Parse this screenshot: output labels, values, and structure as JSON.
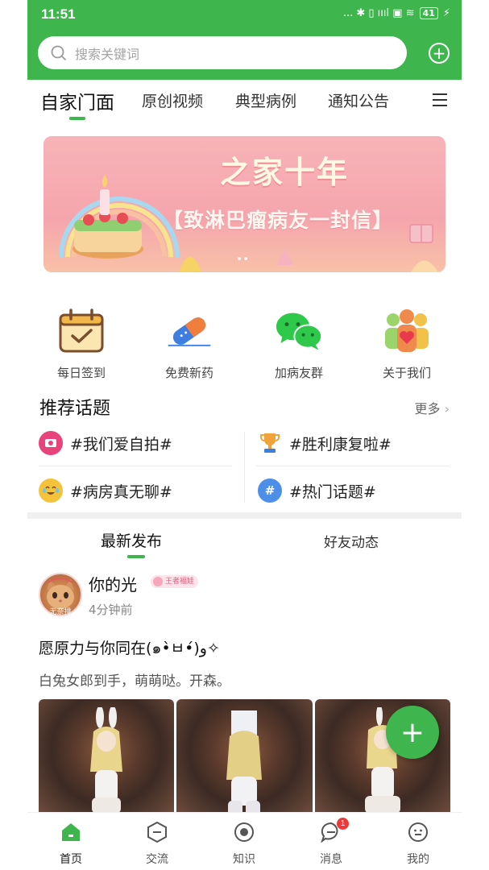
{
  "status_bar": {
    "time": "11:51",
    "icons_text": "... ✱ ▯ ıııl ▣ ≋",
    "battery": "41"
  },
  "search": {
    "placeholder": "搜索关键词"
  },
  "tabs": [
    {
      "label": "自家门面",
      "active": true
    },
    {
      "label": "原创视频",
      "active": false
    },
    {
      "label": "典型病例",
      "active": false
    },
    {
      "label": "通知公告",
      "active": false
    }
  ],
  "banner": {
    "title": "之家十年",
    "subtitle": "【致淋巴瘤病友一封信】"
  },
  "quick_actions": [
    {
      "label": "每日签到",
      "icon": "calendar-check-icon"
    },
    {
      "label": "免费新药",
      "icon": "pill-icon"
    },
    {
      "label": "加病友群",
      "icon": "wechat-icon"
    },
    {
      "label": "关于我们",
      "icon": "people-heart-icon"
    }
  ],
  "topics_section": {
    "title": "推荐话题",
    "more": "更多"
  },
  "topics": [
    {
      "label": "#我们爱自拍#",
      "icon": "selfie-icon",
      "color": "#e8437a"
    },
    {
      "label": "#胜利康复啦#",
      "icon": "trophy-icon",
      "color": "#f2a23a"
    },
    {
      "label": "#病房真无聊#",
      "icon": "cat-emoji-icon",
      "color": "#f5c33b"
    },
    {
      "label": "#热门话题#",
      "icon": "hashtag-icon",
      "color": "#4d8fe8"
    }
  ],
  "feed_tabs": {
    "latest": "最新发布",
    "friends": "好友动态"
  },
  "post": {
    "avatar_label": "无奈排",
    "username": "你的光",
    "badge": "王者福娃",
    "time": "4分钟前",
    "title": "愿原力与你同在(๑•̀ㅂ•́)و✧",
    "body": "白兔女郎到手，萌萌哒。开森。",
    "photo_count": 3
  },
  "fab": {
    "label": "+"
  },
  "bottom_nav": [
    {
      "label": "首页",
      "icon": "home-icon",
      "active": true
    },
    {
      "label": "交流",
      "icon": "exchange-icon",
      "active": false
    },
    {
      "label": "知识",
      "icon": "knowledge-icon",
      "active": false
    },
    {
      "label": "消息",
      "icon": "message-icon",
      "active": false,
      "badge": "1"
    },
    {
      "label": "我的",
      "icon": "profile-icon",
      "active": false
    }
  ],
  "colors": {
    "brand_green": "#3fb54e",
    "badge_red": "#ec3a3a"
  }
}
